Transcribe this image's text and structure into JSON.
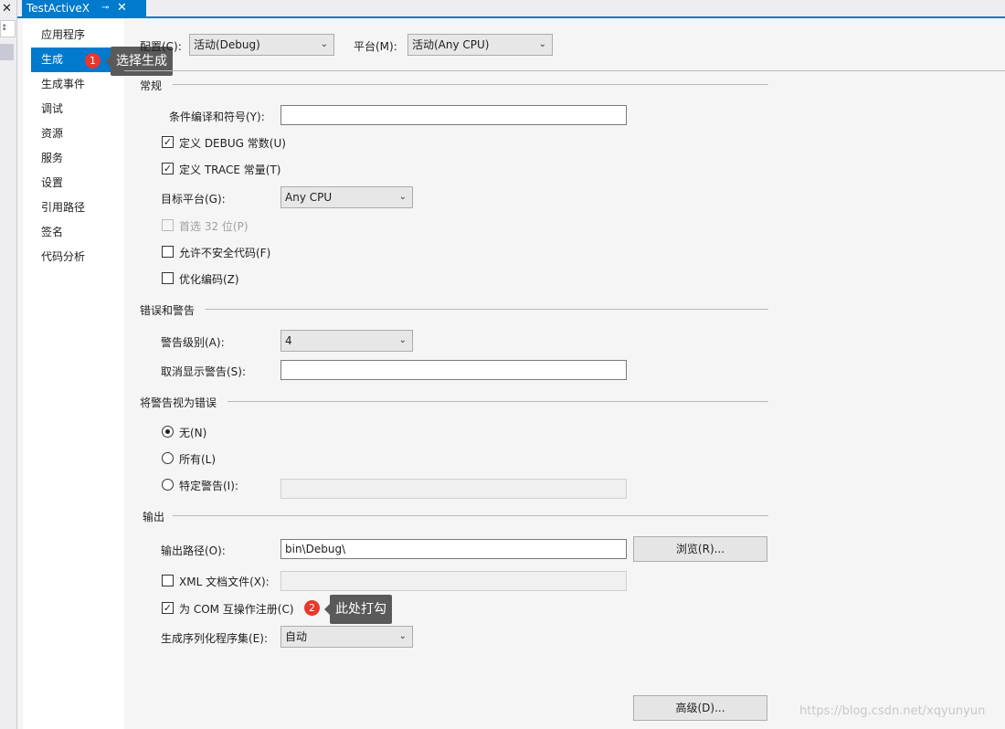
{
  "tab": {
    "title": "TestActiveX",
    "pin": "⊸",
    "close": "✕"
  },
  "leftstrip": {
    "close": "✕",
    "combo": "↕"
  },
  "nav": [
    "应用程序",
    "生成",
    "生成事件",
    "调试",
    "资源",
    "服务",
    "设置",
    "引用路径",
    "签名",
    "代码分析"
  ],
  "header": {
    "config_label": "配置(C):",
    "config_value": "活动(Debug)",
    "platform_label": "平台(M):",
    "platform_value": "活动(Any CPU)"
  },
  "general": {
    "title": "常规",
    "symbols_label": "条件编译和符号(Y):",
    "debug_label": "定义 DEBUG 常数(U)",
    "trace_label": "定义 TRACE 常量(T)",
    "target_label": "目标平台(G):",
    "target_value": "Any CPU",
    "prefer32_label": "首选 32 位(P)",
    "unsafe_label": "允许不安全代码(F)",
    "optimize_label": "优化编码(Z)"
  },
  "errors": {
    "title": "错误和警告",
    "level_label": "警告级别(A):",
    "level_value": "4",
    "suppress_label": "取消显示警告(S):"
  },
  "treat": {
    "title": "将警告视为错误",
    "none_label": "无(N)",
    "all_label": "所有(L)",
    "specific_label": "特定警告(I):"
  },
  "output": {
    "title": "输出",
    "path_label": "输出路径(O):",
    "path_value": "bin\\Debug\\",
    "browse_label": "浏览(R)...",
    "xml_label": "XML 文档文件(X):",
    "com_label": "为 COM 互操作注册(C)",
    "serial_label": "生成序列化程序集(E):",
    "serial_value": "自动"
  },
  "advanced_label": "高级(D)...",
  "callouts": [
    {
      "num": "1",
      "text": "选择生成"
    },
    {
      "num": "2",
      "text": "此处打勾"
    }
  ],
  "watermark": "https://blog.csdn.net/xqyunyun",
  "checkmark": "✓",
  "chevron": "⌄"
}
